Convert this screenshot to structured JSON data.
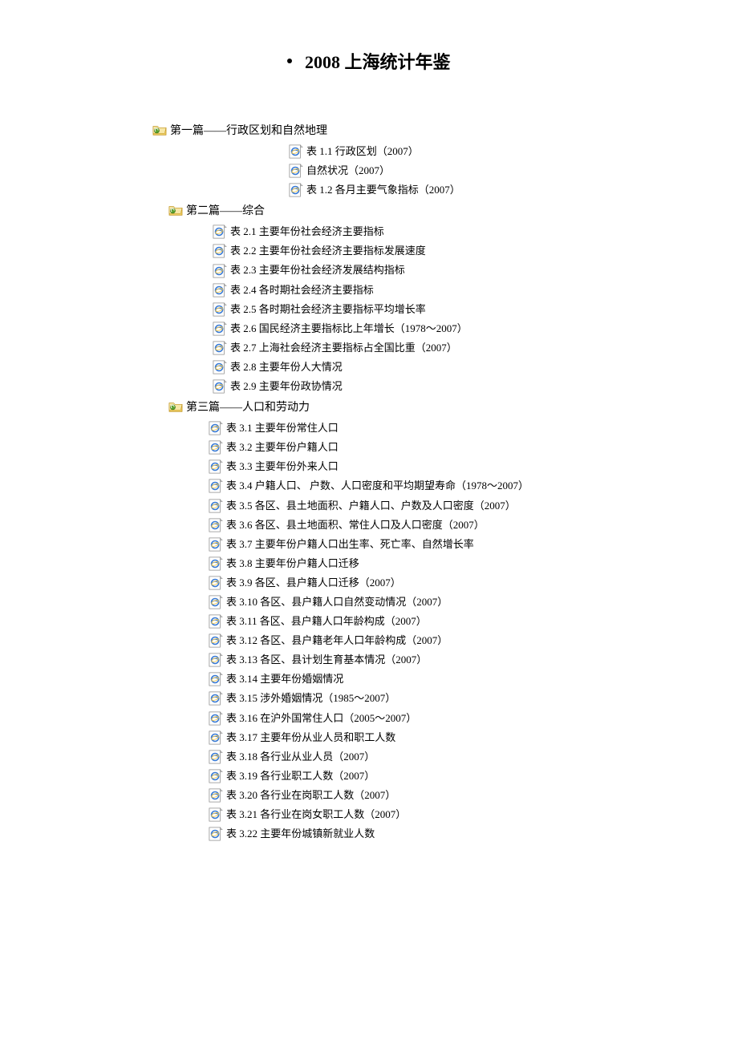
{
  "title": "2008 上海统计年鉴",
  "sections": [
    {
      "title": "第一篇——行政区划和自然地理",
      "items": [
        "表 1.1 行政区划（2007）",
        "自然状况（2007）",
        "表 1.2 各月主要气象指标（2007）"
      ]
    },
    {
      "title": "第二篇——综合",
      "items": [
        "表 2.1 主要年份社会经济主要指标",
        "表 2.2 主要年份社会经济主要指标发展速度",
        "表 2.3 主要年份社会经济发展结构指标",
        "表 2.4 各时期社会经济主要指标",
        "表 2.5 各时期社会经济主要指标平均增长率",
        "表 2.6 国民经济主要指标比上年增长（1978～2007）",
        "表 2.7 上海社会经济主要指标占全国比重（2007）",
        "表 2.8 主要年份人大情况",
        "表 2.9 主要年份政协情况"
      ]
    },
    {
      "title": "第三篇——人口和劳动力",
      "items": [
        "表 3.1 主要年份常住人口",
        "表 3.2 主要年份户籍人口",
        "表 3.3 主要年份外来人口",
        "表 3.4 户籍人口、 户数、人口密度和平均期望寿命（1978～2007）",
        "表 3.5 各区、县土地面积、户籍人口、户数及人口密度（2007）",
        "表 3.6 各区、县土地面积、常住人口及人口密度（2007）",
        "表 3.7 主要年份户籍人口出生率、死亡率、自然增长率",
        "表 3.8 主要年份户籍人口迁移",
        "表 3.9 各区、县户籍人口迁移（2007）",
        "表 3.10 各区、县户籍人口自然变动情况（2007）",
        "表 3.11 各区、县户籍人口年龄构成（2007）",
        "表 3.12 各区、县户籍老年人口年龄构成（2007）",
        "表 3.13 各区、县计划生育基本情况（2007）",
        "表 3.14 主要年份婚姻情况",
        "表 3.15 涉外婚姻情况（1985～2007）",
        "表 3.16 在沪外国常住人口（2005～2007）",
        "表 3.17 主要年份从业人员和职工人数",
        "表 3.18 各行业从业人员（2007）",
        "表 3.19 各行业职工人数（2007）",
        "表 3.20 各行业在岗职工人数（2007）",
        "表 3.21 各行业在岗女职工人数（2007）",
        "表 3.22 主要年份城镇新就业人数"
      ]
    }
  ]
}
